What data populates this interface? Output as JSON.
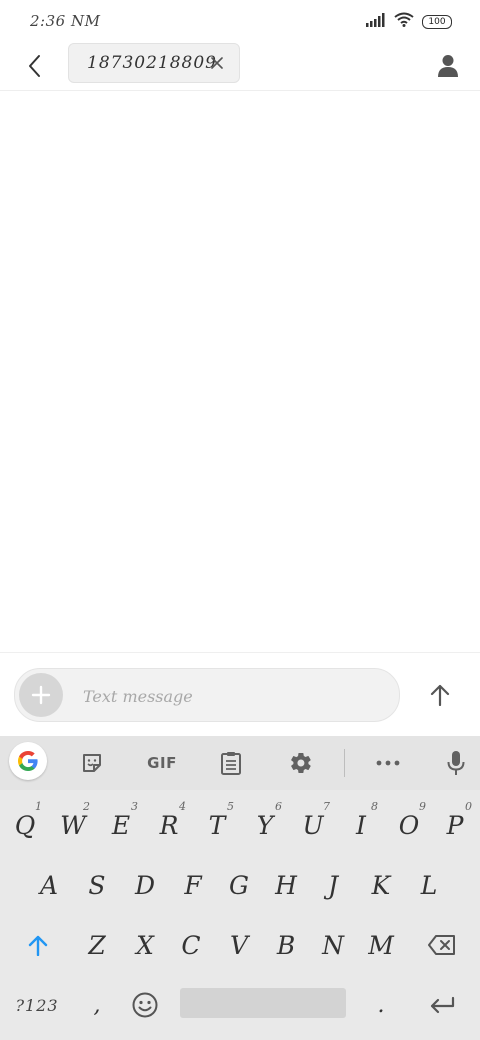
{
  "status_bar": {
    "time": "2:36 NM",
    "battery": "100"
  },
  "header": {
    "recipient": "18730218809"
  },
  "compose": {
    "placeholder": "Text message"
  },
  "keyboard": {
    "toolbar": {
      "gif_label": "GIF"
    },
    "row1": [
      {
        "label": "Q",
        "hint": "1"
      },
      {
        "label": "W",
        "hint": "2"
      },
      {
        "label": "E",
        "hint": "3"
      },
      {
        "label": "R",
        "hint": "4"
      },
      {
        "label": "T",
        "hint": "5"
      },
      {
        "label": "Y",
        "hint": "6"
      },
      {
        "label": "U",
        "hint": "7"
      },
      {
        "label": "I",
        "hint": "8"
      },
      {
        "label": "O",
        "hint": "9"
      },
      {
        "label": "P",
        "hint": "0"
      }
    ],
    "row2": [
      {
        "label": "A"
      },
      {
        "label": "S"
      },
      {
        "label": "D"
      },
      {
        "label": "F"
      },
      {
        "label": "G"
      },
      {
        "label": "H"
      },
      {
        "label": "J"
      },
      {
        "label": "K"
      },
      {
        "label": "L"
      }
    ],
    "row3": [
      {
        "label": "Z"
      },
      {
        "label": "X"
      },
      {
        "label": "C"
      },
      {
        "label": "V"
      },
      {
        "label": "B"
      },
      {
        "label": "N"
      },
      {
        "label": "M"
      }
    ],
    "row4": {
      "symbols_label": "?123",
      "comma": ",",
      "period": "."
    }
  },
  "colors": {
    "accent": "#2196f3",
    "keyboard_bg": "#e9e9e9",
    "toolbar_bg": "#e4e4e4",
    "icon_gray": "#616161"
  }
}
